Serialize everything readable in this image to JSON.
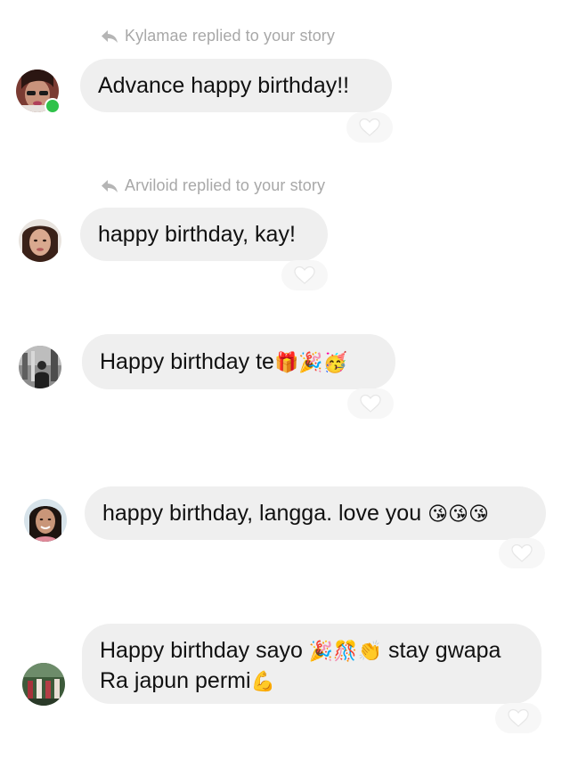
{
  "conversation": {
    "messages": [
      {
        "reply_context": "Kylamae replied to your story",
        "text": "Advance happy birthday!!",
        "emojis": "",
        "avatar": "avatar-kylamae",
        "online": true
      },
      {
        "reply_context": "Arviloid replied to your story",
        "text": "happy birthday, kay!",
        "emojis": "",
        "avatar": "avatar-arviloid",
        "online": false
      },
      {
        "reply_context": "",
        "text": "Happy birthday te",
        "emojis": "🎁🎉🥳",
        "avatar": "avatar-user-3",
        "online": false
      },
      {
        "reply_context": "",
        "text": "happy birthday, langga. love you",
        "emojis": "😘😘😘",
        "avatar": "avatar-user-4",
        "online": false
      },
      {
        "reply_context": "",
        "text_line1": "Happy birthday sayo",
        "emojis_line1": "🎉🎊👏",
        "text_line1_after": "stay gwapa",
        "text_line2": "Ra japun permi",
        "emojis_line2": "💪",
        "avatar": "avatar-user-5",
        "online": false
      }
    ]
  },
  "icons": {
    "reply": "reply-arrow-icon",
    "like": "heart-icon"
  },
  "colors": {
    "bubble": "#efefef",
    "muted_text": "#a8a8a8",
    "online": "#2fc24a",
    "heart_pill": "#f7f7f7"
  }
}
